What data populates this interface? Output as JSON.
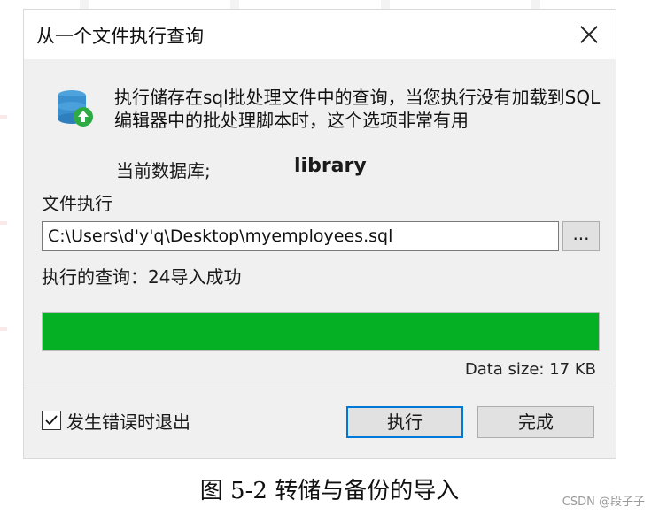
{
  "dialog": {
    "title": "从一个文件执行查询",
    "description": "执行储存在sql批处理文件中的查询，当您执行没有加载到SQL编辑器中的批处理脚本时，这个选项非常有用",
    "current_db_label": "当前数据库;",
    "current_db_value": "library",
    "file_label": "文件执行",
    "file_path": "C:\\Users\\d'y'q\\Desktop\\myemployees.sql",
    "browse_label": "...",
    "executed_label": "执行的查询：24导入成功",
    "progress_fraction": 1.0,
    "progress_color": "#06b025",
    "data_size": "Data size: 17 KB",
    "stop_on_error_label": "发生错误时退出",
    "stop_on_error_checked": true,
    "execute_label": "执行",
    "done_label": "完成"
  },
  "caption": "图 5-2 转储与备份的导入",
  "watermark": "CSDN @段子子"
}
